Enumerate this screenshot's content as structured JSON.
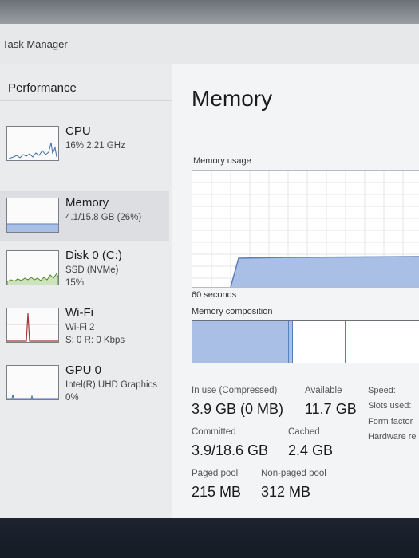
{
  "window": {
    "title": "Task Manager"
  },
  "sidebar": {
    "section": "Performance",
    "items": [
      {
        "name": "CPU",
        "line1": "16%  2.21 GHz",
        "line2": "",
        "line3": ""
      },
      {
        "name": "Memory",
        "line1": "4.1/15.8 GB (26%)",
        "line2": "",
        "line3": ""
      },
      {
        "name": "Disk 0 (C:)",
        "line1": "SSD (NVMe)",
        "line2": "15%",
        "line3": ""
      },
      {
        "name": "Wi-Fi",
        "line1": "Wi-Fi 2",
        "line2": "S: 0  R: 0 Kbps",
        "line3": ""
      },
      {
        "name": "GPU 0",
        "line1": "Intel(R) UHD Graphics",
        "line2": "0%",
        "line3": ""
      }
    ]
  },
  "main": {
    "title": "Memory",
    "usage_label": "Memory usage",
    "time_label": "60 seconds",
    "composition_label": "Memory composition",
    "stats": {
      "in_use_label": "In use (Compressed)",
      "in_use_value": "3.9 GB (0 MB)",
      "available_label": "Available",
      "available_value": "11.7 GB",
      "committed_label": "Committed",
      "committed_value": "3.9/18.6 GB",
      "cached_label": "Cached",
      "cached_value": "2.4 GB",
      "paged_label": "Paged pool",
      "paged_value": "215 MB",
      "nonpaged_label": "Non-paged pool",
      "nonpaged_value": "312 MB"
    },
    "side": {
      "speed_label": "Speed:",
      "slots_label": "Slots used:",
      "form_label": "Form factor",
      "hw_label": "Hardware re"
    }
  },
  "colors": {
    "memory_fill": "#a9bfe6",
    "memory_line": "#5b7fb8",
    "cpu": "#3f6fa8",
    "disk": "#4f8a24",
    "wifi": "#a4373a",
    "gpu": "#3f6fa8"
  },
  "icons": [
    "cpu-graph-icon",
    "memory-graph-icon",
    "disk-graph-icon",
    "wifi-graph-icon",
    "gpu-graph-icon"
  ]
}
